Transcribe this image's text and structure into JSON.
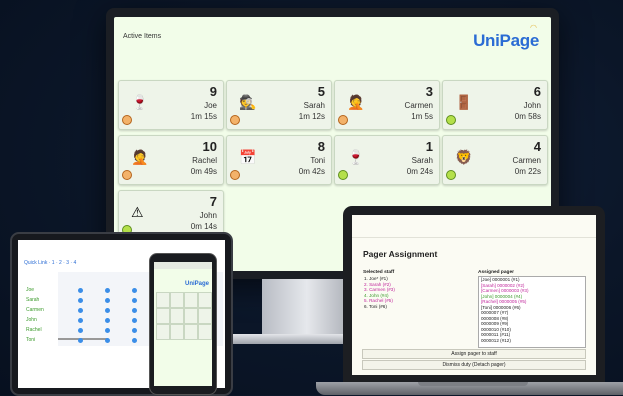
{
  "monitor": {
    "title": "Active Items",
    "logo": "UniPage",
    "cards": [
      {
        "num": "9",
        "name": "Joe",
        "time": "1m 15s",
        "icon": "🍷",
        "dot": "orange"
      },
      {
        "num": "5",
        "name": "Sarah",
        "time": "1m 12s",
        "icon": "🕵️",
        "dot": "orange"
      },
      {
        "num": "3",
        "name": "Carmen",
        "time": "1m 5s",
        "icon": "🤦",
        "dot": "orange"
      },
      {
        "num": "6",
        "name": "John",
        "time": "0m 58s",
        "icon": "🚪",
        "dot": "green"
      },
      {
        "num": "10",
        "name": "Rachel",
        "time": "0m 49s",
        "icon": "🤦",
        "dot": "orange"
      },
      {
        "num": "8",
        "name": "Toni",
        "time": "0m 42s",
        "icon": "📅",
        "dot": "orange"
      },
      {
        "num": "1",
        "name": "Sarah",
        "time": "0m 24s",
        "icon": "🍷",
        "dot": "green"
      },
      {
        "num": "4",
        "name": "Carmen",
        "time": "0m 22s",
        "icon": "🦁",
        "dot": "green"
      },
      {
        "num": "7",
        "name": "John",
        "time": "0m 14s",
        "icon": "⚠",
        "dot": "green"
      }
    ]
  },
  "tablet": {
    "title": "Quick Link · 1 · 2 · 3 · 4",
    "staff": [
      "Joe",
      "Sarah",
      "Carmen",
      "John",
      "Rachel",
      "Toni"
    ]
  },
  "phone": {
    "logo": "UniPage"
  },
  "laptop": {
    "title": "Pager Assignment",
    "selected_label": "Selected staff",
    "assigned_label": "Assigned pager",
    "staff": [
      {
        "text": "1. Joe* (#1)",
        "color": "#222"
      },
      {
        "text": "2. Sarah (#2)",
        "color": "#c0269b"
      },
      {
        "text": "3. Carmen (#3)",
        "color": "#c0269b"
      },
      {
        "text": "4. John (#4)",
        "color": "#3a9a2a"
      },
      {
        "text": "5. Rachel (#5)",
        "color": "#c0269b"
      },
      {
        "text": "6. Toni (#6)",
        "color": "#222"
      }
    ],
    "pagers": [
      {
        "text": "[Joe] 0000001 (#1)",
        "color": "#222"
      },
      {
        "text": "[Sarah] 0000002 (#2)",
        "color": "#c0269b"
      },
      {
        "text": "[Carmen] 0000003 (#3)",
        "color": "#c0269b"
      },
      {
        "text": "[John] 0000004 (#4)",
        "color": "#3a9a2a"
      },
      {
        "text": "[Rachel] 0000005 (#5)",
        "color": "#c0269b"
      },
      {
        "text": "[Toni] 0000006 (#6)",
        "color": "#222"
      },
      {
        "text": "0000007 (#7)",
        "color": "#222"
      },
      {
        "text": "0000008 (#8)",
        "color": "#222"
      },
      {
        "text": "0000009 (#9)",
        "color": "#222"
      },
      {
        "text": "0000010 (#10)",
        "color": "#222"
      },
      {
        "text": "0000011 (#11)",
        "color": "#222"
      },
      {
        "text": "0000012 (#12)",
        "color": "#222"
      }
    ],
    "assign_button": "Assign pager to staff",
    "dismiss_button": "Dismiss duty (Detach pager)"
  }
}
